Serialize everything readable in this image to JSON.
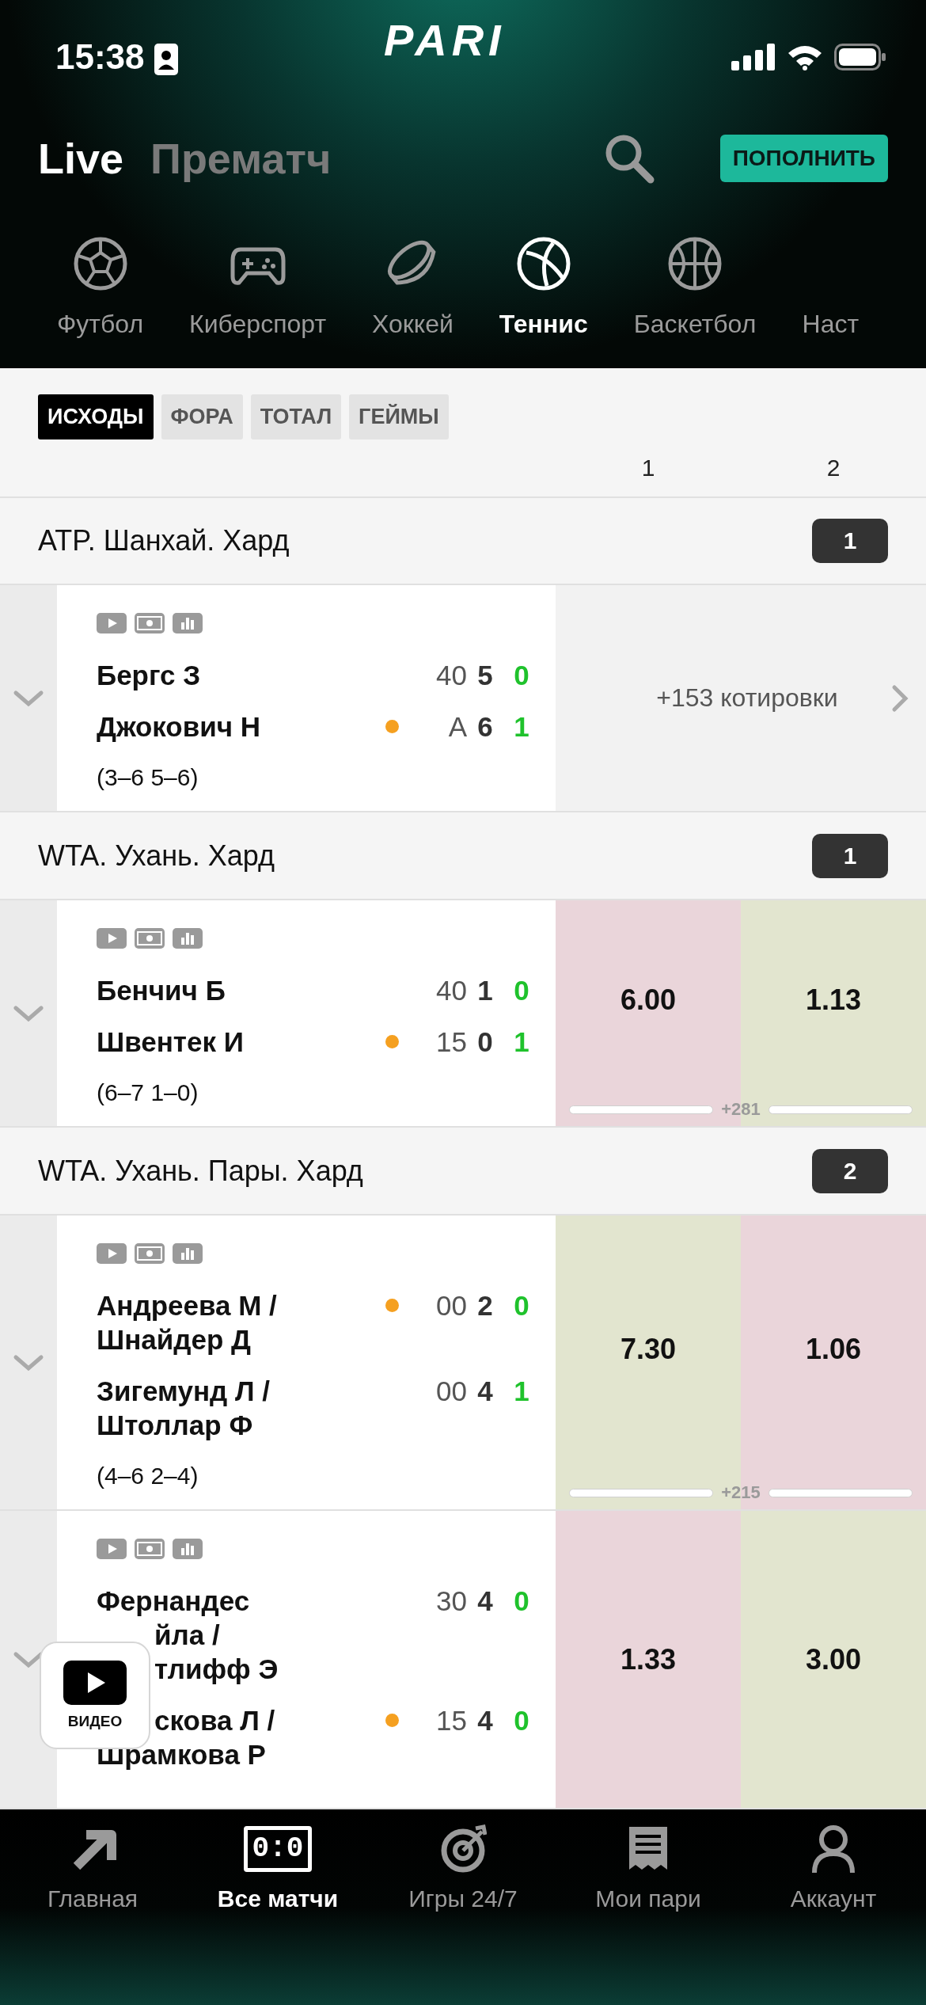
{
  "status_bar": {
    "time": "15:38"
  },
  "logo": "PARI",
  "modes": [
    {
      "label": "Live",
      "selected": true
    },
    {
      "label": "Прематч",
      "selected": false
    }
  ],
  "deposit_button": "ПОПОЛНИТЬ",
  "sports": [
    {
      "label": "Футбол",
      "selected": false
    },
    {
      "label": "Киберспорт",
      "selected": false
    },
    {
      "label": "Хоккей",
      "selected": false
    },
    {
      "label": "Теннис",
      "selected": true
    },
    {
      "label": "Баскетбол",
      "selected": false
    },
    {
      "label": "Наст",
      "selected": false
    }
  ],
  "markets": [
    {
      "label": "ИСХОДЫ",
      "selected": true
    },
    {
      "label": "ФОРА",
      "selected": false
    },
    {
      "label": "ТОТАЛ",
      "selected": false
    },
    {
      "label": "ГЕЙМЫ",
      "selected": false
    }
  ],
  "columns": [
    "1",
    "2"
  ],
  "groups": [
    {
      "title": "ATP. Шанхай. Хард",
      "count": "1",
      "matches": [
        {
          "kind": "more",
          "players": [
            {
              "lines": [
                {
                  "text": "Бергс З",
                  "covered": false
                }
              ],
              "serving": false,
              "points": "40",
              "games": "5",
              "sets": "0"
            },
            {
              "lines": [
                {
                  "text": "Джокович Н",
                  "covered": false
                }
              ],
              "serving": true,
              "points": "A",
              "games": "6",
              "sets": "1"
            }
          ],
          "sets_line": "(3–6 5–6)",
          "more_markets": "+153 котировки"
        }
      ]
    },
    {
      "title": "WTA. Ухань. Хард",
      "count": "1",
      "matches": [
        {
          "kind": "odds",
          "players": [
            {
              "lines": [
                {
                  "text": "Бенчич Б",
                  "covered": false
                }
              ],
              "serving": false,
              "points": "40",
              "games": "1",
              "sets": "0"
            },
            {
              "lines": [
                {
                  "text": "Швентек И",
                  "covered": false
                }
              ],
              "serving": true,
              "points": "15",
              "games": "0",
              "sets": "1"
            }
          ],
          "sets_line": "(6–7 1–0)",
          "odds": [
            {
              "value": "6.00",
              "rising": false
            },
            {
              "value": "1.13",
              "rising": true
            }
          ],
          "extra": "+281"
        }
      ]
    },
    {
      "title": "WTA. Ухань. Пары. Хард",
      "count": "2",
      "matches": [
        {
          "kind": "odds",
          "players": [
            {
              "lines": [
                {
                  "text": "Андреева М / Шнайдер Д",
                  "covered": false
                }
              ],
              "serving": true,
              "points": "00",
              "games": "2",
              "sets": "0"
            },
            {
              "lines": [
                {
                  "text": "Зигемунд Л / Штоллар Ф",
                  "covered": false
                }
              ],
              "serving": false,
              "points": "00",
              "games": "4",
              "sets": "1"
            }
          ],
          "sets_line": "(4–6 2–4)",
          "odds": [
            {
              "value": "7.30",
              "rising": true
            },
            {
              "value": "1.06",
              "rising": false
            }
          ],
          "extra": "+215"
        },
        {
          "kind": "odds",
          "players": [
            {
              "lines": [
                {
                  "text": "Фернандес",
                  "covered": false
                },
                {
                  "text": "йла /",
                  "covered": true
                },
                {
                  "text": "тлифф Э",
                  "covered": true
                }
              ],
              "serving": false,
              "points": "30",
              "games": "4",
              "sets": "0"
            },
            {
              "lines": [
                {
                  "text": "скова Л /",
                  "covered": true
                },
                {
                  "text": "Шрамкова Р",
                  "covered": false
                }
              ],
              "serving": true,
              "points": "15",
              "games": "4",
              "sets": "0"
            }
          ],
          "odds": [
            {
              "value": "1.33",
              "rising": false
            },
            {
              "value": "3.00",
              "rising": true
            }
          ]
        }
      ]
    }
  ],
  "video_button": {
    "label": "ВИДЕО"
  },
  "nav": [
    {
      "label": "Главная",
      "selected": false
    },
    {
      "label": "Все матчи",
      "selected": true,
      "icon_text": "0:0"
    },
    {
      "label": "Игры 24/7",
      "selected": false
    },
    {
      "label": "Мои пари",
      "selected": false
    },
    {
      "label": "Аккаунт",
      "selected": false
    }
  ]
}
